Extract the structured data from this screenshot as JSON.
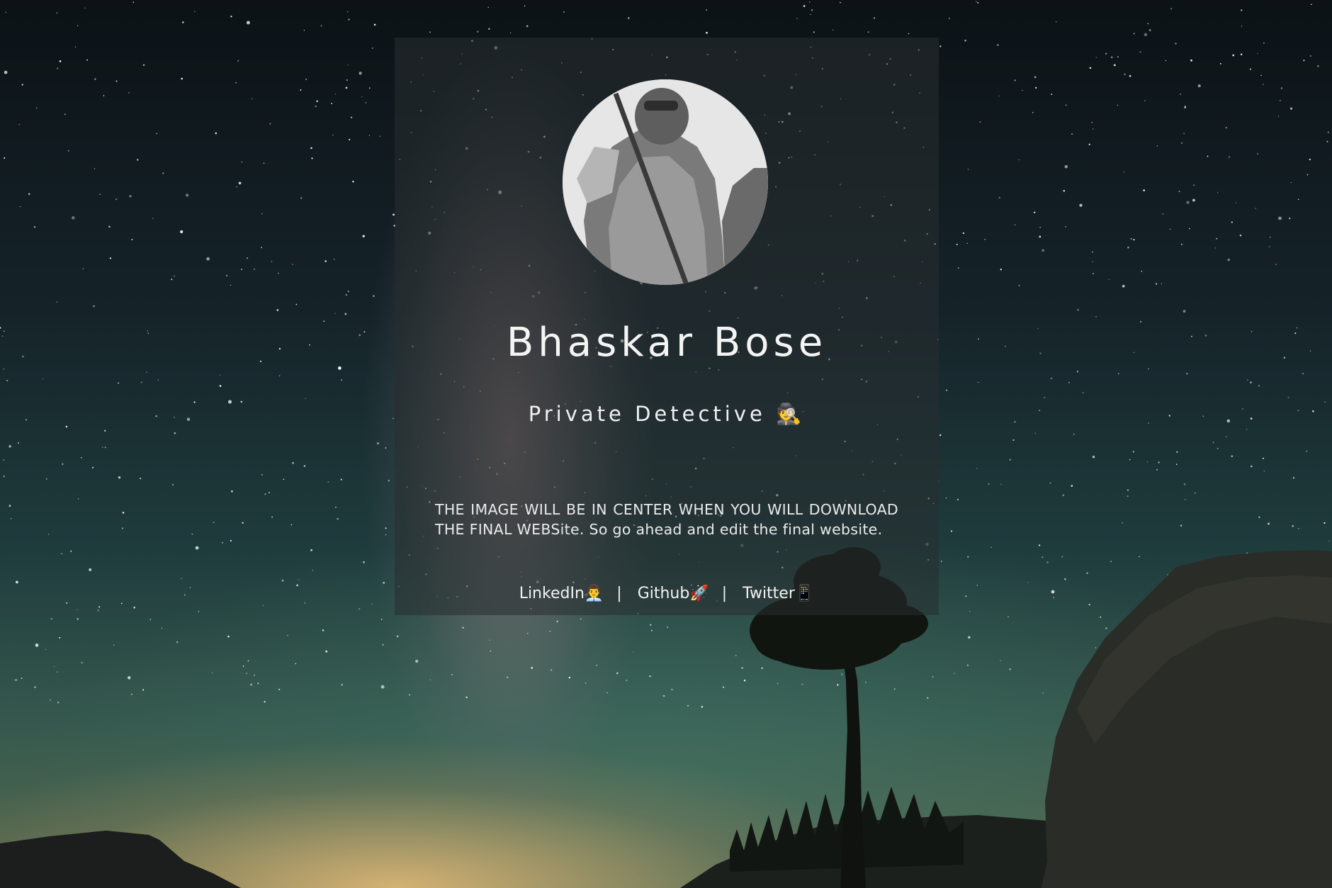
{
  "profile": {
    "name": "Bhaskar Bose",
    "role": "Private Detective 🕵️",
    "description": "THE IMAGE WILL BE IN CENTER WHEN YOU WILL DOWNLOAD THE FINAL WEBSite. So go ahead and edit the final website.",
    "avatar_icon": "hooded-figure-photo"
  },
  "links": [
    {
      "label": "LinkedIn👨‍💼"
    },
    {
      "label": "Github🚀"
    },
    {
      "label": "Twitter📱"
    }
  ],
  "separator": "|",
  "colors": {
    "card_overlay": "rgba(40,45,48,0.55)",
    "text": "#ffffff"
  }
}
